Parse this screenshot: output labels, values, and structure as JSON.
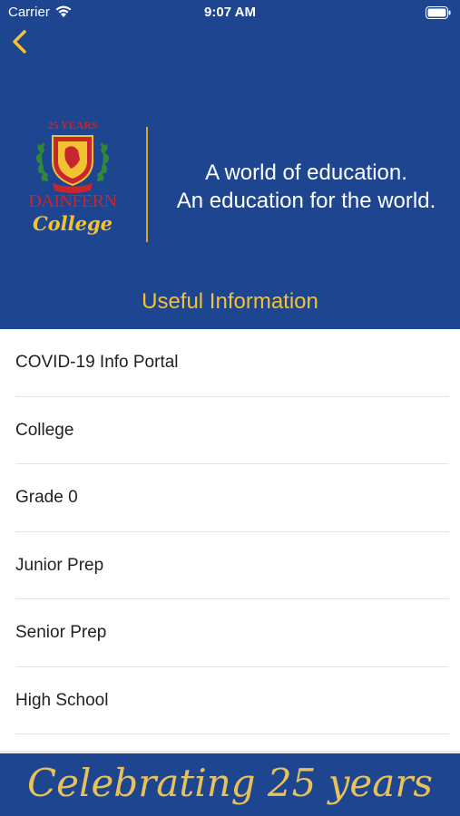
{
  "status_bar": {
    "carrier": "Carrier",
    "time": "9:07 AM"
  },
  "logo": {
    "years": "25 YEARS",
    "name_top": "DAINFERN",
    "name_bottom": "College"
  },
  "tagline": {
    "line1": "A world of education.",
    "line2": "An education for the world."
  },
  "section_title": "Useful Information",
  "items": [
    {
      "label": "COVID-19 Info Portal"
    },
    {
      "label": "College"
    },
    {
      "label": "Grade 0"
    },
    {
      "label": "Junior Prep"
    },
    {
      "label": "Senior Prep"
    },
    {
      "label": "High School"
    }
  ],
  "footer": {
    "text": "Celebrating 25 years"
  },
  "colors": {
    "brand_blue": "#1d4590",
    "gold": "#f1c232",
    "red": "#c8262e"
  }
}
